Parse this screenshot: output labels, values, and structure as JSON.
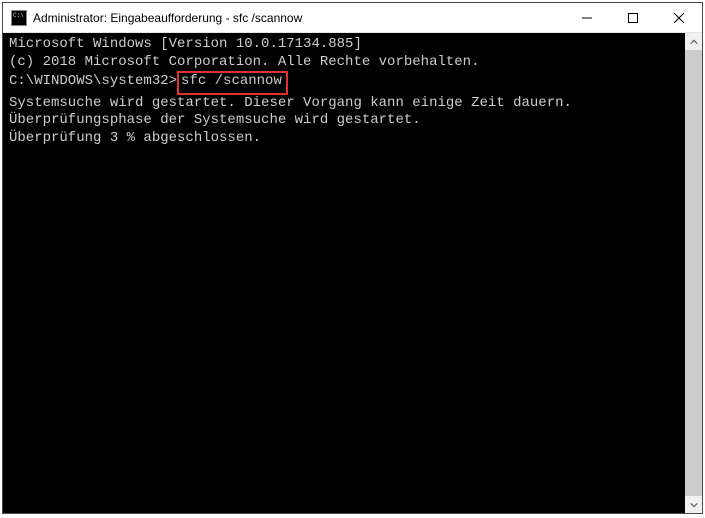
{
  "titlebar": {
    "title": "Administrator: Eingabeaufforderung - sfc  /scannow"
  },
  "terminal": {
    "line1": "Microsoft Windows [Version 10.0.17134.885]",
    "line2": "(c) 2018 Microsoft Corporation. Alle Rechte vorbehalten.",
    "blank1": "",
    "prompt": "C:\\WINDOWS\\system32>",
    "command": "sfc /scannow",
    "blank2": "",
    "line3": "Systemsuche wird gestartet. Dieser Vorgang kann einige Zeit dauern.",
    "blank3": "",
    "line4": "Überprüfungsphase der Systemsuche wird gestartet.",
    "line5": "Überprüfung 3 % abgeschlossen."
  }
}
